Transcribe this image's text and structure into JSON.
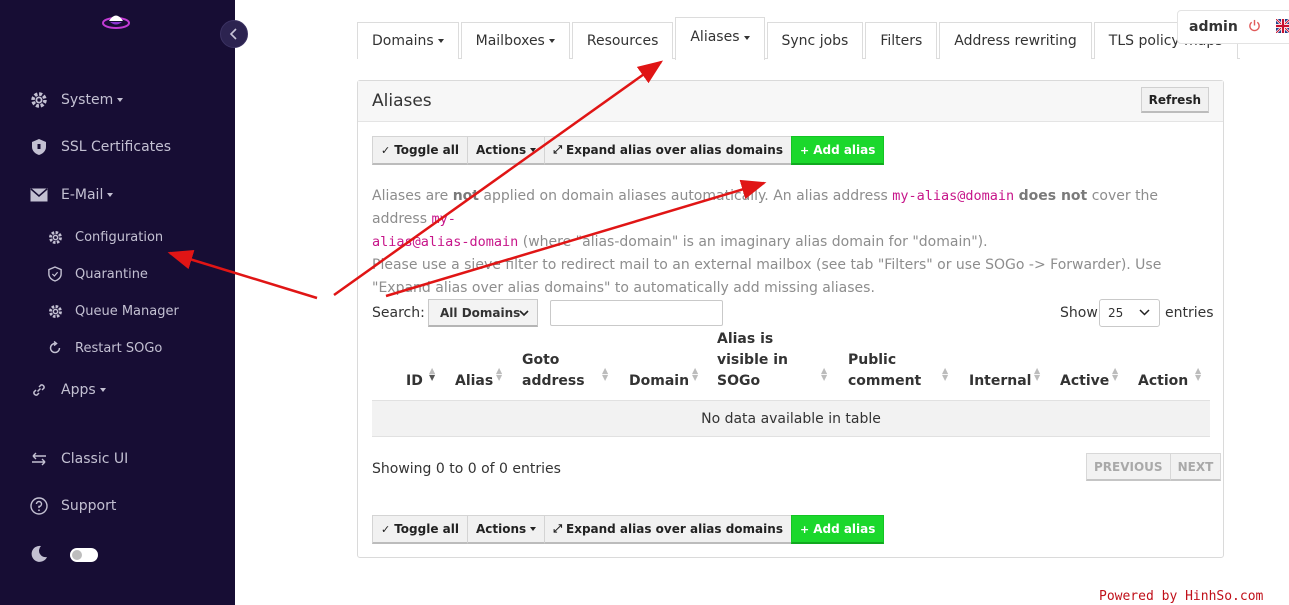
{
  "sidebar": {
    "items": [
      {
        "label": "System",
        "icon": "gear-icon",
        "has_caret": true
      },
      {
        "label": "SSL Certificates",
        "icon": "shield-icon"
      },
      {
        "label": "E-Mail",
        "icon": "envelope-icon",
        "has_caret": true
      },
      {
        "label": "Configuration",
        "icon": "gear-icon"
      },
      {
        "label": "Quarantine",
        "icon": "shield-outline-icon"
      },
      {
        "label": "Queue Manager",
        "icon": "gear-icon"
      },
      {
        "label": "Restart SOGo",
        "icon": "refresh-icon"
      },
      {
        "label": "Apps",
        "icon": "link-icon",
        "has_caret": true
      },
      {
        "label": "Classic UI",
        "icon": "swap-arrows-icon"
      },
      {
        "label": "Support",
        "icon": "question-icon"
      }
    ],
    "theme_toggle": "moon-icon"
  },
  "tabs": [
    {
      "label": "Domains",
      "caret": true
    },
    {
      "label": "Mailboxes",
      "caret": true
    },
    {
      "label": "Resources"
    },
    {
      "label": "Aliases",
      "caret": true,
      "active": true
    },
    {
      "label": "Sync jobs"
    },
    {
      "label": "Filters"
    },
    {
      "label": "Address rewriting"
    },
    {
      "label": "TLS policy maps"
    }
  ],
  "user": {
    "name": "admin"
  },
  "panel": {
    "title": "Aliases",
    "refresh": "Refresh",
    "toolbar": {
      "toggle_all": "Toggle all",
      "actions": "Actions",
      "expand": "Expand alias over alias domains",
      "add_alias": "Add alias"
    },
    "help": {
      "p1_a": "Aliases are ",
      "p1_not": "not",
      "p1_b": " applied on domain aliases automatically. An alias address ",
      "p1_code1": "my-alias@domain",
      "p1_doesnot": "does not",
      "p1_c": " cover the address ",
      "p1_code2a": "my-",
      "p1_code2b": "alias@alias-domain",
      "p1_d": " (where \"alias-domain\" is an imaginary alias domain for \"domain\").",
      "p2": "Please use a sieve filter to redirect mail to an external mailbox (see tab \"Filters\" or use SOGo -> Forwarder). Use \"Expand alias over alias domains\" to automatically add missing aliases."
    },
    "search": {
      "label": "Search:",
      "domain_select": "All Domains",
      "show": "Show",
      "entries_value": "25",
      "entries": "entries"
    },
    "table": {
      "columns": [
        "ID",
        "Alias",
        "Goto address",
        "Domain",
        "Alias is visible in SOGo",
        "Public comment",
        "Internal",
        "Active",
        "Action"
      ],
      "empty": "No data available in table"
    },
    "showing": "Showing 0 to 0 of 0 entries",
    "pager": {
      "previous": "PREVIOUS",
      "next": "NEXT"
    }
  },
  "watermark": "Powered by HinhSo.com",
  "colors": {
    "sidebar_bg": "#170d34",
    "success": "#1bd82c",
    "code": "#c7168a",
    "arrow": "#e01515"
  }
}
